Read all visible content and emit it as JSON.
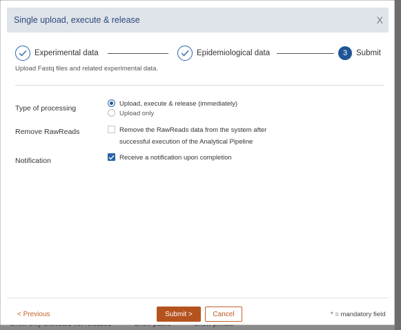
{
  "dialog": {
    "title": "Single upload, execute & release",
    "close_symbol": "X"
  },
  "stepper": {
    "steps": [
      {
        "label": "Experimental data",
        "state": "complete",
        "icon": "check-icon"
      },
      {
        "label": "Epidemiological data",
        "state": "complete",
        "icon": "check-icon"
      },
      {
        "label": "Submit",
        "state": "current",
        "number": "3"
      }
    ],
    "subtitle": "Upload Fastq files and related experimental data."
  },
  "form": {
    "processing": {
      "label": "Type of processing",
      "options": [
        {
          "text": "Upload, execute & release (immediately)",
          "selected": true
        },
        {
          "text": "Upload only",
          "selected": false
        }
      ]
    },
    "remove_rawreads": {
      "label": "Remove RawReads",
      "line1": "Remove the RawReads data from the system after",
      "line2": "successful execution of the Analytical Pipeline",
      "checked": false
    },
    "notification": {
      "label": "Notification",
      "text": "Receive a notification upon completion",
      "checked": true
    }
  },
  "footer": {
    "previous": "< Previous",
    "submit": "Submit >",
    "cancel": "Cancel",
    "mandatory_note": "* = mandatory field"
  },
  "background": {
    "footer_items": [
      "Show only executed not released",
      "Show public",
      "Show private"
    ]
  },
  "colors": {
    "accent_blue": "#1f5594",
    "header_bg": "#dfe3ea",
    "action_orange": "#b5531f"
  }
}
